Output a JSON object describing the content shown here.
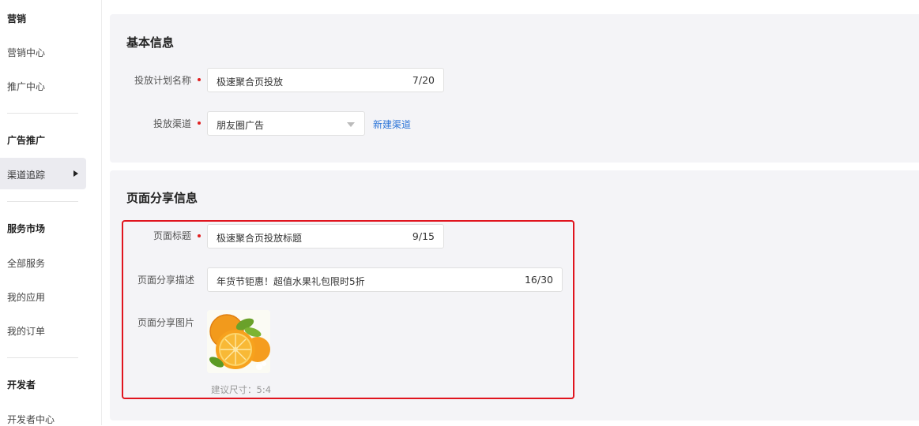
{
  "sidebar": {
    "sections": [
      {
        "title": "营销",
        "items": [
          "营销中心",
          "推广中心"
        ]
      },
      {
        "title": "广告推广",
        "items": [
          "渠道追踪"
        ]
      },
      {
        "title": "服务市场",
        "items": [
          "全部服务",
          "我的应用",
          "我的订单"
        ]
      },
      {
        "title": "开发者",
        "items": [
          "开发者中心"
        ]
      }
    ],
    "active_item": "渠道追踪"
  },
  "basic_info": {
    "title": "基本信息",
    "plan_name": {
      "label": "投放计划名称",
      "value": "极速聚合页投放",
      "counter": "7/20"
    },
    "channel": {
      "label": "投放渠道",
      "value": "朋友圈广告",
      "new_link": "新建渠道"
    }
  },
  "share_info": {
    "title": "页面分享信息",
    "page_title": {
      "label": "页面标题",
      "value": "极速聚合页投放标题",
      "counter": "9/15"
    },
    "description": {
      "label": "页面分享描述",
      "value": "年货节钜惠！超值水果礼包限时5折",
      "counter": "16/30"
    },
    "image": {
      "label": "页面分享图片",
      "hint": "建议尺寸：5:4"
    }
  },
  "colors": {
    "accent_link": "#2f76d8",
    "required_dot": "#e02020",
    "highlight_border": "#e0141e"
  }
}
